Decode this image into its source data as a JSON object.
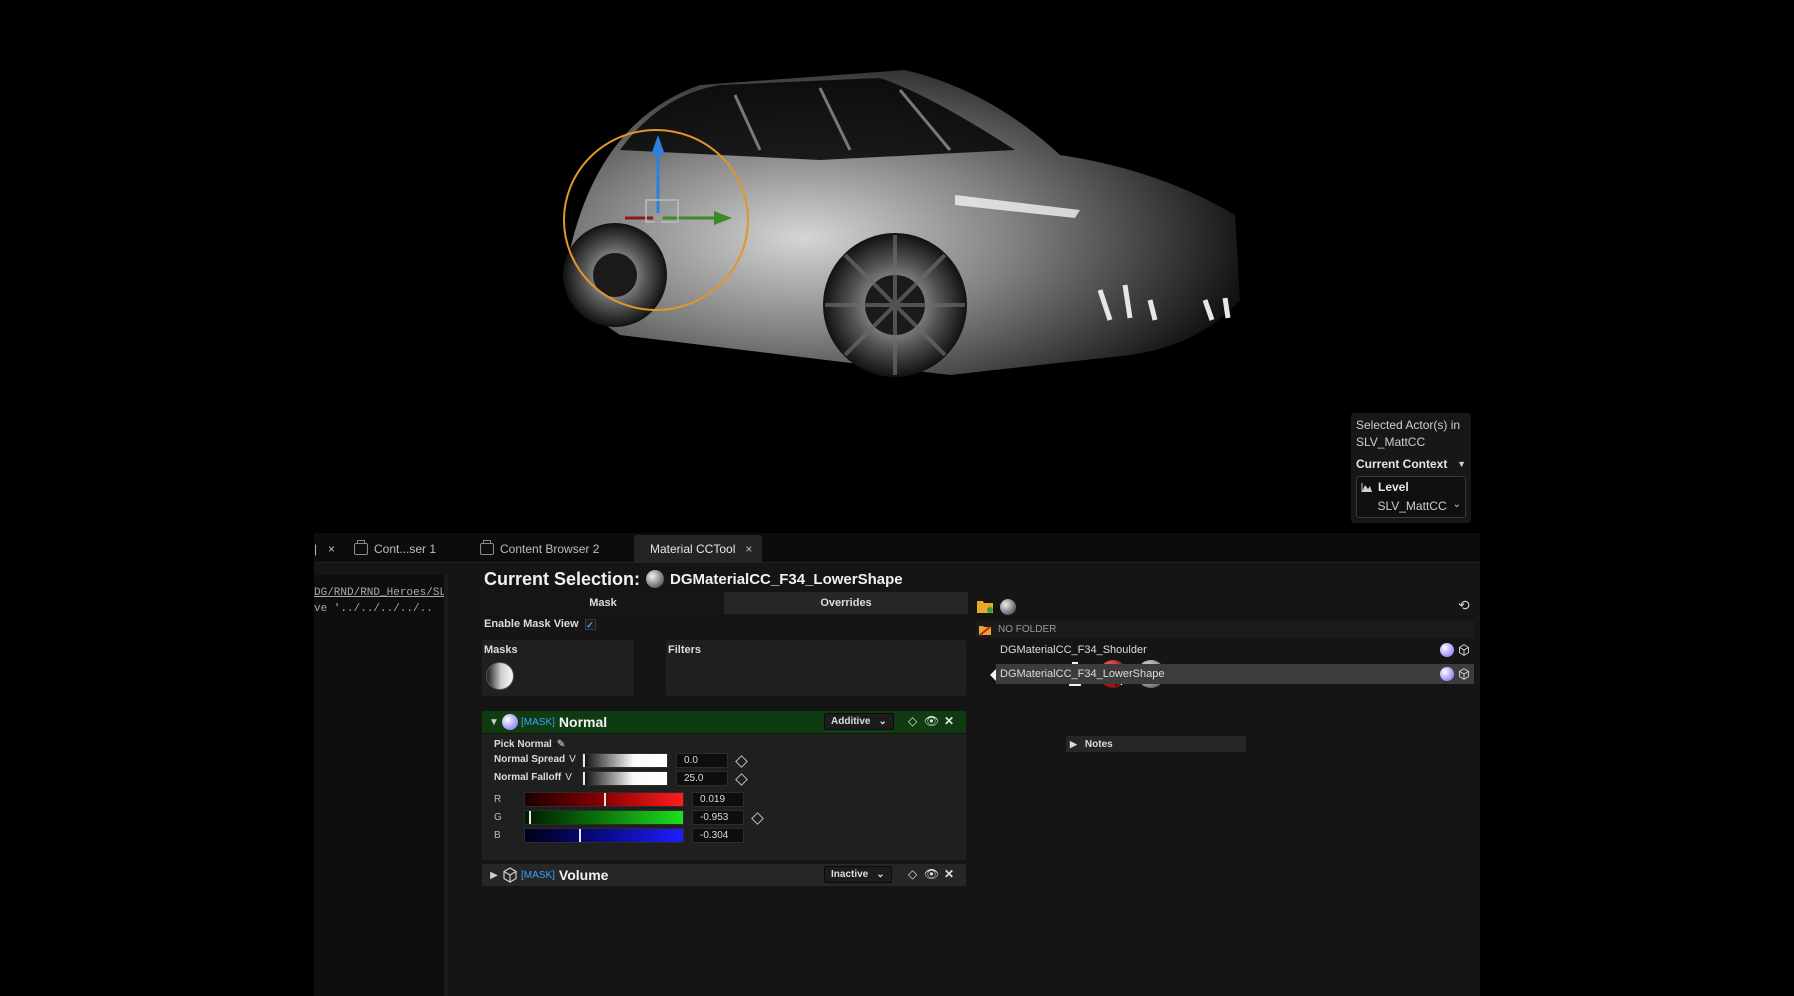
{
  "viewport": {
    "context_panel": {
      "line1": "Selected Actor(s) in",
      "line2": "SLV_MattCC",
      "title": "Current Context",
      "level_label": "Level",
      "level_value": "SLV_MattCC"
    }
  },
  "tabs": [
    {
      "label": "Cont...ser 1"
    },
    {
      "label": "Content Browser 2"
    },
    {
      "label": "Material CCTool"
    }
  ],
  "left_panel": {
    "path": "DG/RND/RND_Heroes/SLV",
    "path2": "ve '../../../../.."
  },
  "selection": {
    "label": "Current Selection:",
    "name": "DGMaterialCC_F34_LowerShape"
  },
  "subtabs": {
    "mask": "Mask",
    "overrides": "Overrides"
  },
  "enable_mask_view": {
    "label": "Enable Mask View",
    "checked": true
  },
  "masks_box": {
    "title": "Masks"
  },
  "filters_box": {
    "title": "Filters",
    "icons": [
      "tag-icon",
      "car-icon",
      "bottle-icon",
      "red-sphere-icon",
      "grey-sphere-icon"
    ]
  },
  "layers": [
    {
      "tag": "[MASK]",
      "name": "Normal",
      "mode": "Additive",
      "expanded": true,
      "pick_label": "Pick Normal",
      "params": [
        {
          "label": "Normal Spread",
          "v": "V",
          "value": "0.0"
        },
        {
          "label": "Normal Falloff",
          "v": "V",
          "value": "25.0"
        }
      ],
      "rgb": [
        {
          "label": "R",
          "value": "0.019",
          "fill": 0.509
        },
        {
          "label": "G",
          "value": "-0.953",
          "fill": 0.023
        },
        {
          "label": "B",
          "value": "-0.304",
          "fill": 0.348
        }
      ]
    },
    {
      "tag": "[MASK]",
      "name": "Volume",
      "mode": "Inactive",
      "expanded": false
    }
  ],
  "notes": {
    "label": "Notes"
  },
  "list": {
    "folder": "NO FOLDER",
    "items": [
      {
        "label": "DGMaterialCC_F34_Shoulder",
        "selected": false
      },
      {
        "label": "DGMaterialCC_F34_LowerShape",
        "selected": true
      }
    ]
  },
  "colors": {
    "mask_tag": "#3aa3ff",
    "normal_header": "#0f3b10",
    "selected_row": "#3c3c3c",
    "gizmo_ring": "#e0962a"
  }
}
